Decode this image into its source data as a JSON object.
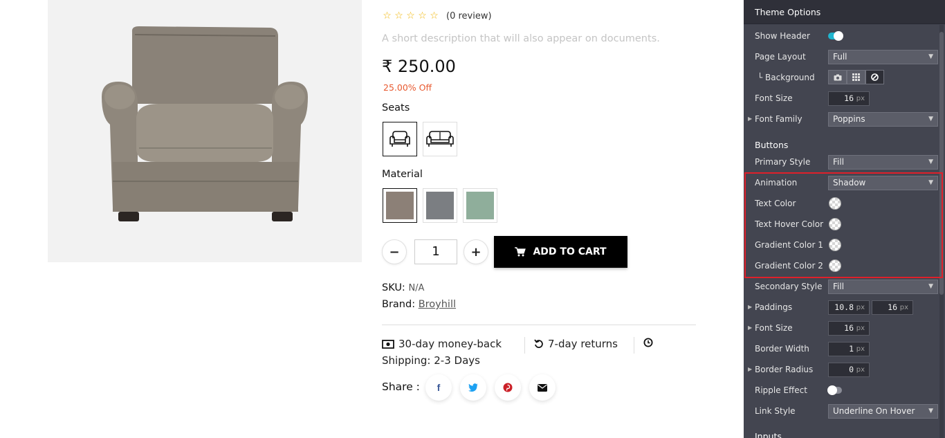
{
  "product": {
    "stars": [
      "☆",
      "☆",
      "☆",
      "☆",
      "☆"
    ],
    "review_count": "(0 review)",
    "short_description": "A short description that will also appear on documents.",
    "price": "₹ 250.00",
    "discount": "25.00% Off",
    "seats_label": "Seats",
    "material_label": "Material",
    "materials": [
      {
        "color": "#8c8077",
        "selected": true
      },
      {
        "color": "#7b7e82",
        "selected": false
      },
      {
        "color": "#8fae9b",
        "selected": false
      }
    ],
    "quantity": "1",
    "minus_label": "−",
    "plus_label": "+",
    "add_to_cart": "ADD TO CART",
    "sku_label": "SKU:",
    "sku_value": "N/A",
    "brand_label": "Brand:",
    "brand_value": "Broyhill",
    "money_back": "30-day money-back",
    "returns": "7-day returns",
    "shipping": "Shipping: 2-3 Days",
    "share_label": "Share :"
  },
  "panel": {
    "title": "Theme Options",
    "show_header": "Show Header",
    "page_layout": "Page Layout",
    "page_layout_value": "Full",
    "background": "└ Background",
    "font_size": "Font Size",
    "font_size_value": "16",
    "font_family": "Font Family",
    "font_family_value": "Poppins",
    "buttons_section": "Buttons",
    "primary_style": "Primary Style",
    "primary_style_value": "Fill",
    "animation": "Animation",
    "animation_value": "Shadow",
    "text_color": "Text Color",
    "text_hover_color": "Text Hover Color",
    "gradient_color_1": "Gradient Color 1",
    "gradient_color_2": "Gradient Color 2",
    "secondary_style": "Secondary Style",
    "secondary_style_value": "Fill",
    "paddings": "Paddings",
    "paddings_value_1": "10.8",
    "paddings_value_2": "16",
    "btn_font_size": "Font Size",
    "btn_font_size_value": "16",
    "border_width": "Border Width",
    "border_width_value": "1",
    "border_radius": "Border Radius",
    "border_radius_value": "0",
    "ripple_effect": "Ripple Effect",
    "link_style": "Link Style",
    "link_style_value": "Underline On Hover",
    "inputs_section": "Inputs",
    "unit": "px",
    "accent": "#1fb5cf"
  }
}
